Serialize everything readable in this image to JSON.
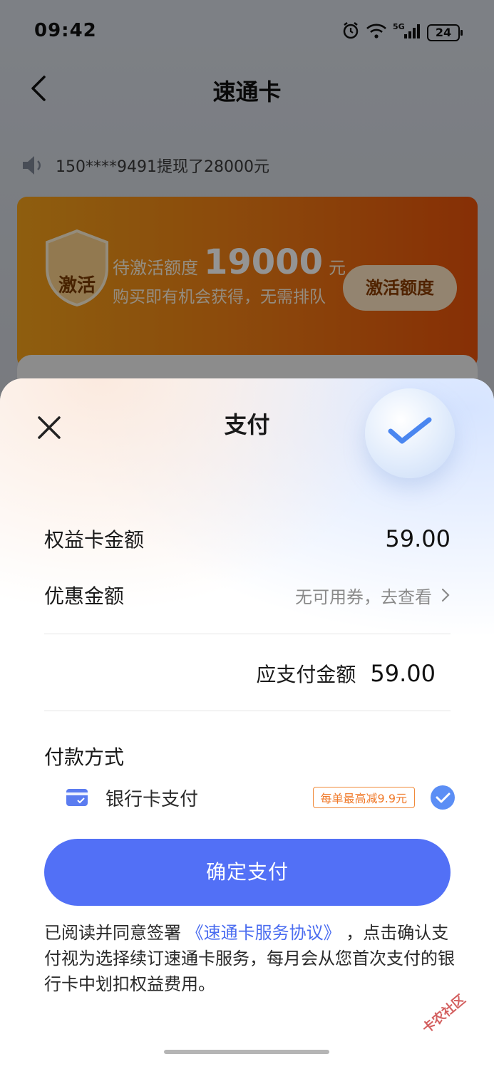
{
  "status_bar": {
    "time": "09:42",
    "battery": "24"
  },
  "nav": {
    "title": "速通卡"
  },
  "notice": {
    "text": "150****9491提现了28000元"
  },
  "promo": {
    "shield_label": "激活",
    "label": "待激活额度",
    "amount": "19000",
    "unit": "元",
    "description": "购买即有机会获得，无需排队",
    "button": "激活额度"
  },
  "sheet": {
    "title": "支付",
    "card_amount_label": "权益卡金额",
    "card_amount_value": "59.00",
    "discount_label": "优惠金额",
    "discount_value": "无可用券，去查看",
    "total_label": "应支付金额",
    "total_value": "59.00",
    "method_title": "付款方式",
    "method_label": "银行卡支付",
    "method_tag": "每单最高减9.9元",
    "pay_button": "确定支付",
    "agreement_prefix": "已阅读并同意签署",
    "agreement_link": "《速通卡服务协议》",
    "agreement_suffix": "，点击确认支付视为选择续订速通卡服务，每月会从您首次支付的银行卡中划扣权益费用。"
  },
  "watermark": "卡农社区",
  "colors": {
    "primary": "#5270f6",
    "link": "#4a6cf0",
    "promo_orange": "#f07a14",
    "tag_orange": "#f07a2a"
  }
}
